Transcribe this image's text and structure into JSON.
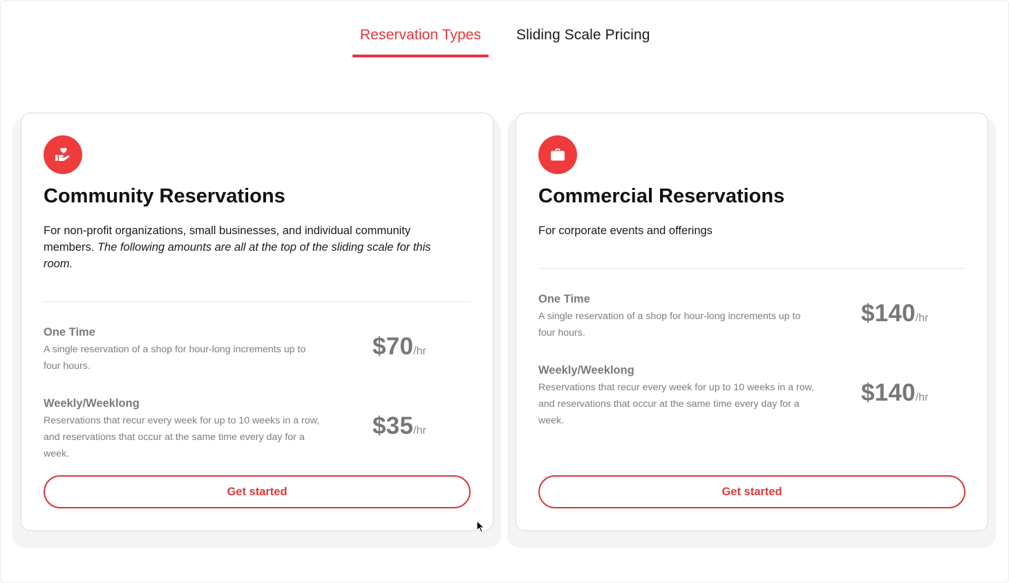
{
  "tabs": [
    {
      "label": "Reservation Types",
      "active": true
    },
    {
      "label": "Sliding Scale Pricing",
      "active": false
    }
  ],
  "cards": [
    {
      "icon": "hand-heart-icon",
      "title": "Community Reservations",
      "description": "For non-profit organizations, small businesses, and individual community members.",
      "description_italic": "The following amounts are all at the top of the sliding scale for this room.",
      "rates": [
        {
          "name": "One Time",
          "description": "A single reservation of a shop for hour-long increments up to four hours.",
          "price": "$70",
          "unit": "/hr"
        },
        {
          "name": "Weekly/Weeklong",
          "description": "Reservations that recur every week for up to 10 weeks in a row, and reservations that occur at the same time every day for a week.",
          "price": "$35",
          "unit": "/hr"
        }
      ],
      "cta_label": "Get started"
    },
    {
      "icon": "briefcase-icon",
      "title": "Commercial Reservations",
      "description": "For corporate events and offerings",
      "rates": [
        {
          "name": "One Time",
          "description": "A single reservation of a shop for hour-long increments up to four hours.",
          "price": "$140",
          "unit": "/hr"
        },
        {
          "name": "Weekly/Weeklong",
          "description": "Reservations that recur every week for up to 10 weeks in a row, and reservations that occur at the same time every day for a week.",
          "price": "$140",
          "unit": "/hr"
        }
      ],
      "cta_label": "Get started"
    }
  ],
  "colors": {
    "accent": "#e8333a",
    "badge": "#ef3b3b",
    "muted_text": "#7a7a7a"
  }
}
